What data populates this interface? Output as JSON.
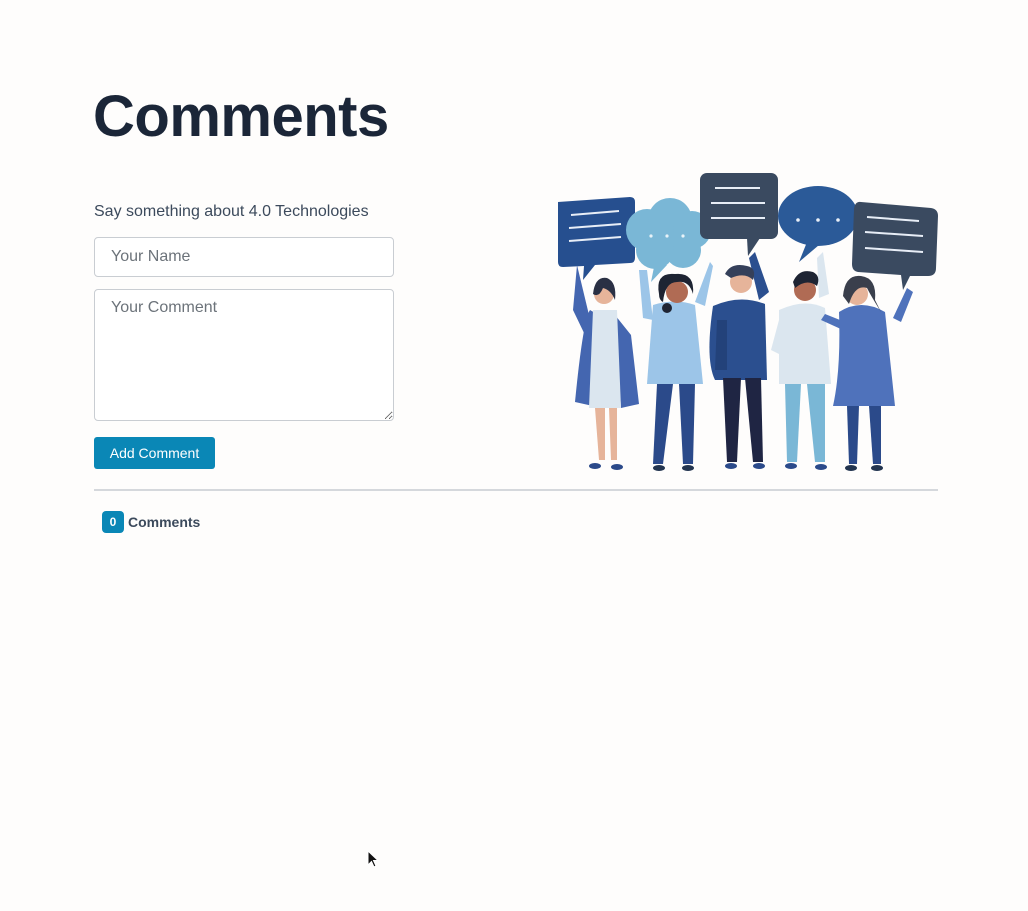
{
  "page": {
    "title": "Comments"
  },
  "form": {
    "prompt": "Say something about 4.0 Technologies",
    "name_placeholder": "Your Name",
    "comment_placeholder": "Your Comment",
    "submit_label": "Add Comment"
  },
  "comments": {
    "count": "0",
    "label": "Comments"
  },
  "illustration": {
    "subject": "people-with-speech-bubbles"
  },
  "colors": {
    "accent": "#0a87b6",
    "heading": "#1b2638",
    "text": "#3c4a5c"
  }
}
